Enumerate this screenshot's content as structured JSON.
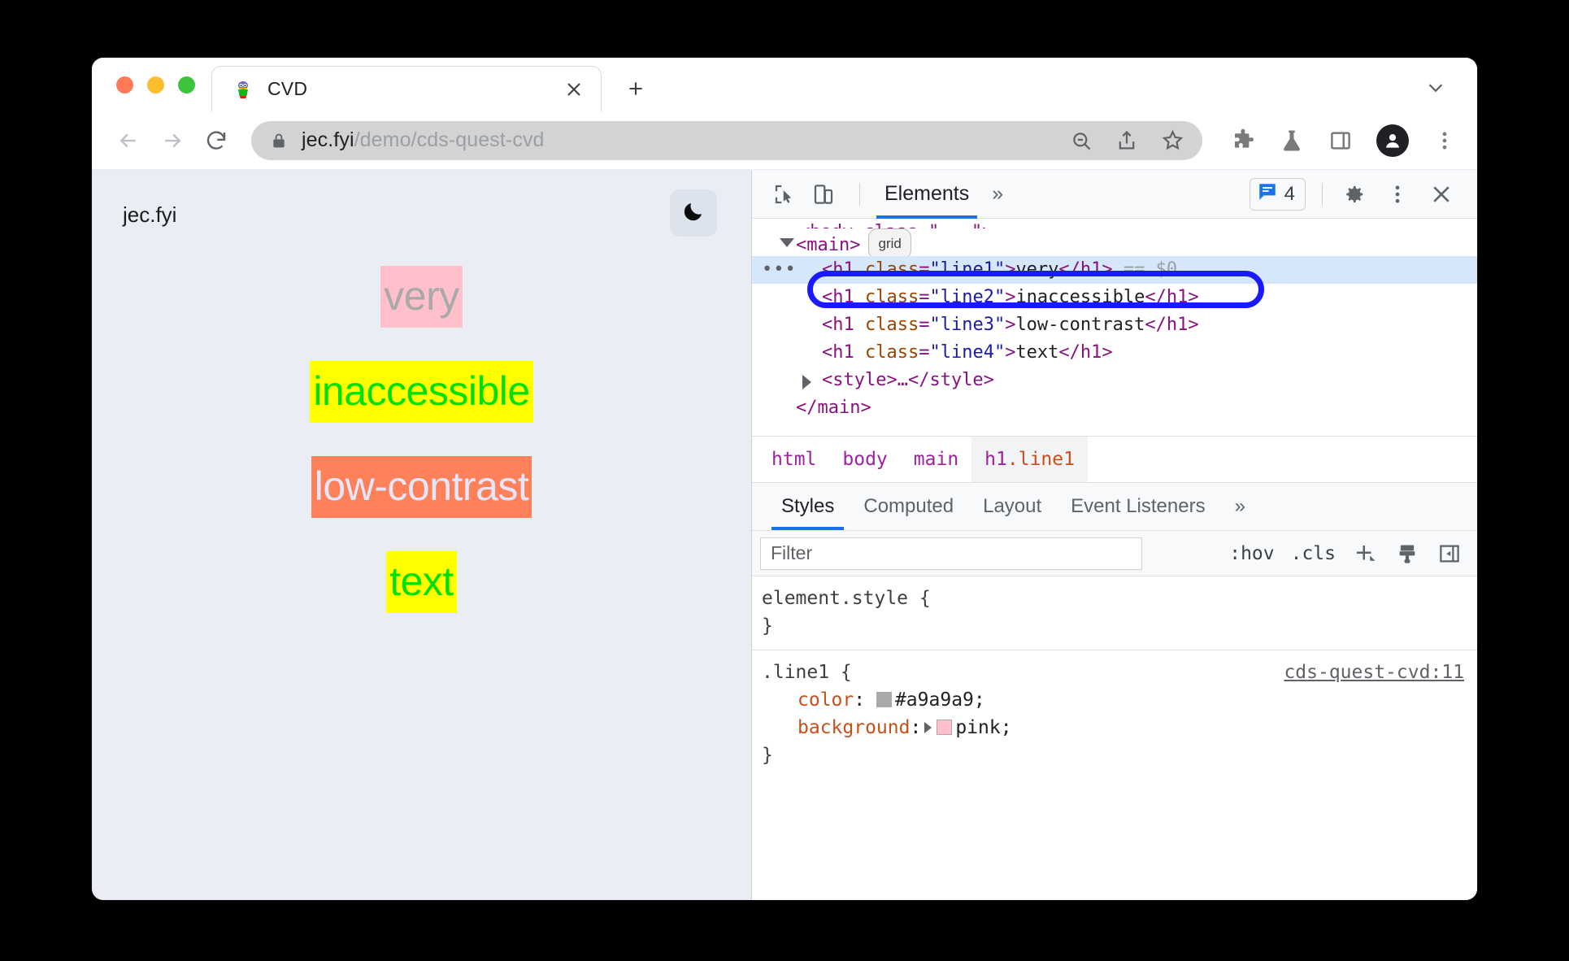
{
  "window": {
    "traffic_lights": [
      "close",
      "minimize",
      "zoom"
    ]
  },
  "tabstrip": {
    "tab_title": "CVD",
    "favicon_name": "cvd-site-favicon",
    "close_label": "✕",
    "new_tab_label": "+",
    "chevron_label": "⌄"
  },
  "toolbar": {
    "back_label": "←",
    "forward_label": "→",
    "reload_label": "↻",
    "url_host": "jec.fyi",
    "url_path": "/demo/cds-quest-cvd",
    "url_full": "jec.fyi/demo/cds-quest-cvd",
    "icons": [
      "zoom-out-icon",
      "share-icon",
      "bookmark-star-icon",
      "extensions-icon",
      "experiments-flask-icon",
      "side-panel-icon",
      "profile-avatar",
      "chrome-menu-icon"
    ]
  },
  "page": {
    "site_name": "jec.fyi",
    "theme_toggle_label": "🌙",
    "lines": [
      {
        "text": "very",
        "color": "#a9a9a9",
        "background": "#ffc0cb"
      },
      {
        "text": "inaccessible",
        "color": "#00e000",
        "background": "#ffff00"
      },
      {
        "text": "low-contrast",
        "color": "#e6e6fa",
        "background": "#ff8159"
      },
      {
        "text": "text",
        "color": "#00e000",
        "background": "#ffff00"
      }
    ]
  },
  "devtools": {
    "toolbar": {
      "inspect_icon": "inspect-element-icon",
      "device_icon": "device-toolbar-icon",
      "active_panel": "Elements",
      "more_panels_label": "»",
      "message_count": "4",
      "message_icon": "console-message-icon",
      "settings_icon": "gear-icon",
      "more_icon": "vertical-dots-icon",
      "close_icon": "close-icon"
    },
    "dom_tree": {
      "clipped_row": "<body class=\"...\">",
      "rows": [
        {
          "indent": 1,
          "twisty": "down",
          "tag_open": "<main>",
          "badge": "grid"
        },
        {
          "indent": 2,
          "selected": true,
          "leading_dots": "•••",
          "tag": "h1",
          "attr_name": "class",
          "attr_value": "line1",
          "text": "very",
          "suffix": "== $0",
          "full": "<h1 class=\"line1\">very</h1> == $0"
        },
        {
          "indent": 2,
          "tag": "h1",
          "attr_name": "class",
          "attr_value": "line2",
          "text": "inaccessible",
          "full": "<h1 class=\"line2\">inaccessible</h1>"
        },
        {
          "indent": 2,
          "tag": "h1",
          "attr_name": "class",
          "attr_value": "line3",
          "text": "low-contrast",
          "full": "<h1 class=\"line3\">low-contrast</h1>"
        },
        {
          "indent": 2,
          "tag": "h1",
          "attr_name": "class",
          "attr_value": "line4",
          "text": "text",
          "full": "<h1 class=\"line4\">text</h1>"
        },
        {
          "indent": 2,
          "twisty": "right",
          "tag_open": "<style>…</style>"
        },
        {
          "indent": 1,
          "tag_open": "</main>"
        }
      ],
      "annotation_ring_color": "#1a1aff"
    },
    "breadcrumb": [
      {
        "label": "html",
        "active": false
      },
      {
        "label": "body",
        "active": false
      },
      {
        "label": "main",
        "active": false
      },
      {
        "label": "h1",
        "class_suffix": ".line1",
        "active": true
      }
    ],
    "styles_tabs": [
      {
        "label": "Styles",
        "active": true
      },
      {
        "label": "Computed",
        "active": false
      },
      {
        "label": "Layout",
        "active": false
      },
      {
        "label": "Event Listeners",
        "active": false
      },
      {
        "label": "more",
        "active": false,
        "glyph": "»"
      }
    ],
    "filter": {
      "placeholder": "Filter",
      "value": "",
      "hov_label": ":hov",
      "cls_label": ".cls",
      "new_rule_icon": "plus-new-style-rule-icon",
      "print_icon": "paint-brush-icon",
      "sidebar_toggle_icon": "computed-sidebar-toggle-icon"
    },
    "rules": [
      {
        "selector": "element.style {",
        "close": "}",
        "source": "",
        "declarations": []
      },
      {
        "selector": ".line1 {",
        "close": "}",
        "source": "cds-quest-cvd:11",
        "declarations": [
          {
            "name": "color",
            "value": "#a9a9a9",
            "swatch": "#a9a9a9",
            "expand": false
          },
          {
            "name": "background",
            "value": "pink",
            "swatch": "#ffc0cb",
            "expand": true
          }
        ]
      }
    ]
  }
}
